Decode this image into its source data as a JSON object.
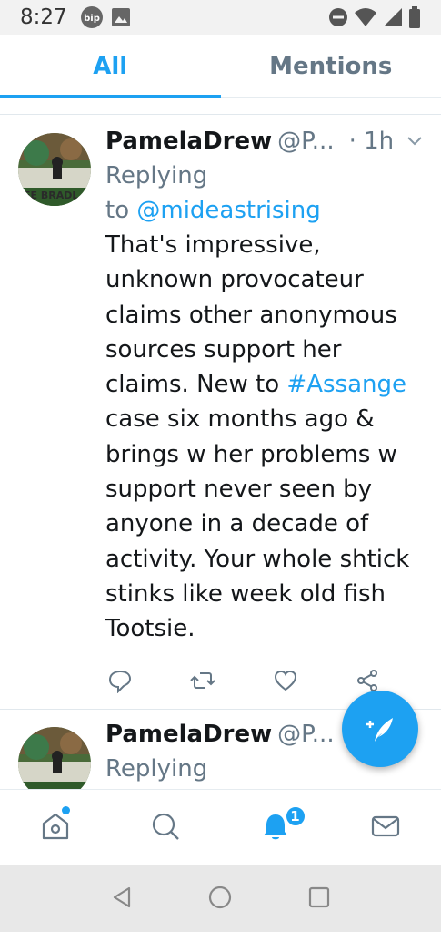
{
  "status_bar": {
    "time": "8:27",
    "app_badge": "bip"
  },
  "tabs": [
    {
      "label": "All",
      "active": true
    },
    {
      "label": "Mentions",
      "active": false
    }
  ],
  "tweets": [
    {
      "name": "PamelaDrew",
      "handle": "@P...",
      "time": "· 1h",
      "replying_prefix": "Replying",
      "replying_to_word": "to",
      "replying_to": "@mideastrising",
      "text_lines": [
        "That's impressive,",
        "unknown provocateur",
        "claims other anonymous",
        "sources support her",
        "claims. New to ",
        "case six months ago &",
        "brings w her problems w",
        "support never seen by",
        "anyone in a decade of",
        "activity. Your whole shtick",
        "stinks like week old fish",
        "Tootsie."
      ],
      "hashtag": "#Assange",
      "avatar_text": "EE BRADL"
    },
    {
      "name": "PamelaDrew",
      "handle": "@P...",
      "replying_prefix": "Replying"
    }
  ],
  "bottom_nav": {
    "notifications_badge": "1"
  },
  "colors": {
    "accent": "#1da1f2",
    "secondary_text": "#657786",
    "primary_text": "#14171a"
  }
}
